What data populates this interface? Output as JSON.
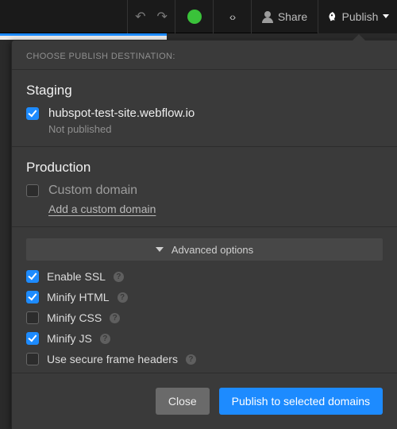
{
  "toolbar": {
    "share_label": "Share",
    "publish_label": "Publish",
    "code_symbol": "‹›"
  },
  "panel": {
    "header": "CHOOSE PUBLISH DESTINATION:",
    "staging": {
      "title": "Staging",
      "domain": "hubspot-test-site.webflow.io",
      "checked": true,
      "status": "Not published"
    },
    "production": {
      "title": "Production",
      "custom_domain_label": "Custom domain",
      "checked": false,
      "add_link": "Add a custom domain"
    },
    "advanced_label": "Advanced options",
    "options": [
      {
        "label": "Enable SSL",
        "checked": true,
        "help": true
      },
      {
        "label": "Minify HTML",
        "checked": true,
        "help": true
      },
      {
        "label": "Minify CSS",
        "checked": false,
        "help": true
      },
      {
        "label": "Minify JS",
        "checked": true,
        "help": true
      },
      {
        "label": "Use secure frame headers",
        "checked": false,
        "help": true
      }
    ],
    "buttons": {
      "close": "Close",
      "publish": "Publish to selected domains"
    }
  }
}
